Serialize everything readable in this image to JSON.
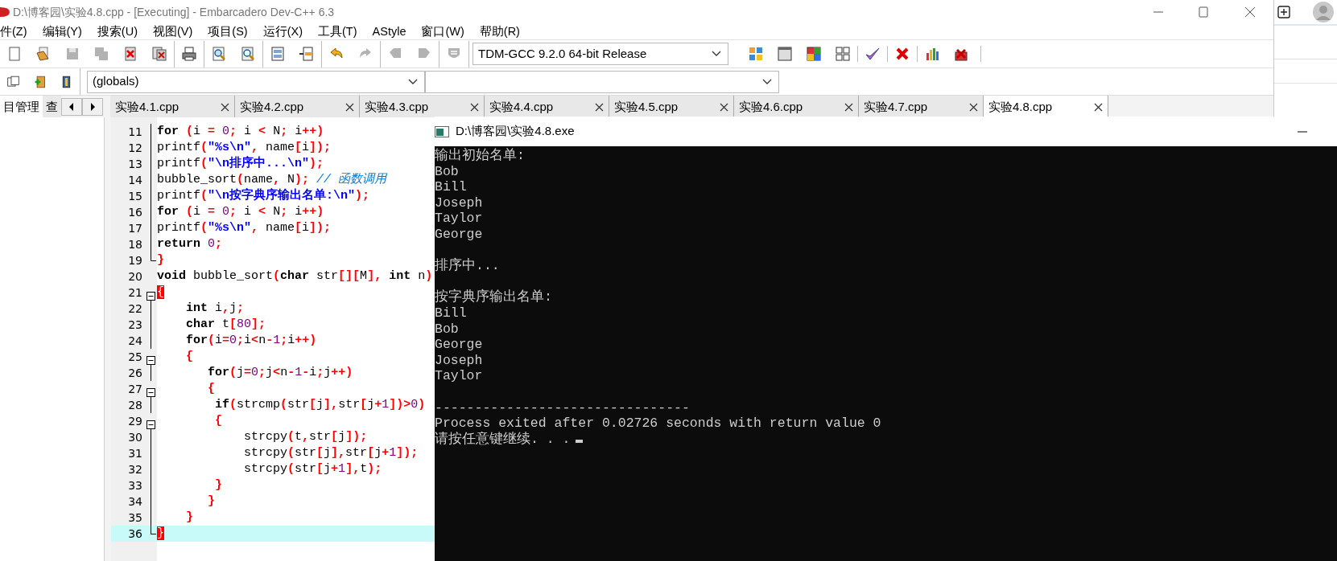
{
  "window": {
    "title": "D:\\博客园\\实验4.8.cpp - [Executing] - Embarcadero Dev-C++ 6.3"
  },
  "menu": [
    "件(Z)",
    "编辑(Y)",
    "搜索(U)",
    "视图(V)",
    "项目(S)",
    "运行(X)",
    "工具(T)",
    "AStyle",
    "窗口(W)",
    "帮助(R)"
  ],
  "toolbar": {
    "buttons": [
      {
        "disabled": false
      },
      {
        "disabled": false
      },
      {
        "disabled": true
      },
      {
        "disabled": true
      },
      {
        "disabled": false
      },
      {
        "disabled": false
      },
      {
        "disabled": false
      },
      {
        "disabled": false
      },
      {
        "disabled": false
      },
      {
        "disabled": false
      },
      {
        "disabled": false
      },
      {
        "disabled": false
      },
      {
        "disabled": true
      },
      {
        "disabled": true
      },
      {
        "disabled": true
      },
      {
        "disabled": true
      }
    ],
    "compiler": "TDM-GCC 9.2.0 64-bit Release",
    "tools": [
      {
        "disabled": false
      },
      {
        "disabled": false
      },
      {
        "disabled": false
      },
      {
        "disabled": false
      },
      {
        "disabled": false
      },
      {
        "disabled": false
      },
      {
        "disabled": false
      },
      {
        "disabled": false
      }
    ]
  },
  "toolbar2": {
    "buttons": [
      {
        "disabled": false
      },
      {
        "disabled": false
      },
      {
        "disabled": false
      }
    ],
    "scope": "(globals)"
  },
  "side_tabs": [
    {
      "label": "目管理",
      "selected": true
    },
    {
      "label": "查",
      "selected": false
    }
  ],
  "file_tabs": [
    {
      "label": "实验4.1.cpp",
      "selected": false
    },
    {
      "label": "实验4.2.cpp",
      "selected": false
    },
    {
      "label": "实验4.3.cpp",
      "selected": false
    },
    {
      "label": "实验4.4.cpp",
      "selected": false
    },
    {
      "label": "实验4.5.cpp",
      "selected": false
    },
    {
      "label": "实验4.6.cpp",
      "selected": false
    },
    {
      "label": "实验4.7.cpp",
      "selected": false
    },
    {
      "label": "实验4.8.cpp",
      "selected": true
    }
  ],
  "editor": {
    "lines": [
      {
        "number": "11",
        "current": false,
        "collapsible": false,
        "code": [
          {
            "kind": "keyword",
            "text": "for"
          },
          {
            "kind": "symbol",
            "text": " ("
          },
          {
            "kind": "plain",
            "text": "i "
          },
          {
            "kind": "symbol",
            "text": "="
          },
          {
            "kind": "number",
            "text": " 0"
          },
          {
            "kind": "symbol",
            "text": ";"
          },
          {
            "kind": "plain",
            "text": " i "
          },
          {
            "kind": "symbol",
            "text": "<"
          },
          {
            "kind": "plain",
            "text": " N"
          },
          {
            "kind": "symbol",
            "text": ";"
          },
          {
            "kind": "plain",
            "text": " i"
          },
          {
            "kind": "symbol",
            "text": "++)"
          }
        ]
      },
      {
        "number": "12",
        "current": false,
        "collapsible": false,
        "code": [
          {
            "kind": "plain",
            "text": "printf"
          },
          {
            "kind": "symbol",
            "text": "("
          },
          {
            "kind": "string",
            "text": "\"%s\\n\""
          },
          {
            "kind": "symbol",
            "text": ","
          },
          {
            "kind": "plain",
            "text": " name"
          },
          {
            "kind": "symbol",
            "text": "["
          },
          {
            "kind": "plain",
            "text": "i"
          },
          {
            "kind": "symbol",
            "text": "]);"
          }
        ]
      },
      {
        "number": "13",
        "current": false,
        "collapsible": false,
        "code": [
          {
            "kind": "plain",
            "text": "printf"
          },
          {
            "kind": "symbol",
            "text": "("
          },
          {
            "kind": "string",
            "text": "\"\\n排序中...\\n\""
          },
          {
            "kind": "symbol",
            "text": ");"
          }
        ]
      },
      {
        "number": "14",
        "current": false,
        "collapsible": false,
        "code": [
          {
            "kind": "plain",
            "text": "bubble_sort"
          },
          {
            "kind": "symbol",
            "text": "("
          },
          {
            "kind": "plain",
            "text": "name"
          },
          {
            "kind": "symbol",
            "text": ","
          },
          {
            "kind": "plain",
            "text": " N"
          },
          {
            "kind": "symbol",
            "text": ");"
          },
          {
            "kind": "comment",
            "text": " // 函数调用"
          }
        ]
      },
      {
        "number": "15",
        "current": false,
        "collapsible": false,
        "code": [
          {
            "kind": "plain",
            "text": "printf"
          },
          {
            "kind": "symbol",
            "text": "("
          },
          {
            "kind": "string",
            "text": "\"\\n按字典序输出名单:\\n\""
          },
          {
            "kind": "symbol",
            "text": ");"
          }
        ]
      },
      {
        "number": "16",
        "current": false,
        "collapsible": false,
        "code": [
          {
            "kind": "keyword",
            "text": "for"
          },
          {
            "kind": "symbol",
            "text": " ("
          },
          {
            "kind": "plain",
            "text": "i "
          },
          {
            "kind": "symbol",
            "text": "="
          },
          {
            "kind": "number",
            "text": " 0"
          },
          {
            "kind": "symbol",
            "text": ";"
          },
          {
            "kind": "plain",
            "text": " i "
          },
          {
            "kind": "symbol",
            "text": "<"
          },
          {
            "kind": "plain",
            "text": " N"
          },
          {
            "kind": "symbol",
            "text": ";"
          },
          {
            "kind": "plain",
            "text": " i"
          },
          {
            "kind": "symbol",
            "text": "++)"
          }
        ]
      },
      {
        "number": "17",
        "current": false,
        "collapsible": false,
        "code": [
          {
            "kind": "plain",
            "text": "printf"
          },
          {
            "kind": "symbol",
            "text": "("
          },
          {
            "kind": "string",
            "text": "\"%s\\n\""
          },
          {
            "kind": "symbol",
            "text": ","
          },
          {
            "kind": "plain",
            "text": " name"
          },
          {
            "kind": "symbol",
            "text": "["
          },
          {
            "kind": "plain",
            "text": "i"
          },
          {
            "kind": "symbol",
            "text": "]);"
          }
        ]
      },
      {
        "number": "18",
        "current": false,
        "collapsible": false,
        "code": [
          {
            "kind": "keyword",
            "text": "return"
          },
          {
            "kind": "number",
            "text": " 0"
          },
          {
            "kind": "symbol",
            "text": ";"
          }
        ]
      },
      {
        "number": "19",
        "current": false,
        "collapsible": false,
        "code": [
          {
            "kind": "symbol",
            "text": "}"
          }
        ]
      },
      {
        "number": "20",
        "current": false,
        "collapsible": false,
        "code": [
          {
            "kind": "keyword",
            "text": "void"
          },
          {
            "kind": "plain",
            "text": " bubble_sort"
          },
          {
            "kind": "symbol",
            "text": "("
          },
          {
            "kind": "keyword",
            "text": "char"
          },
          {
            "kind": "plain",
            "text": " str"
          },
          {
            "kind": "symbol",
            "text": "[]["
          },
          {
            "kind": "plain",
            "text": "M"
          },
          {
            "kind": "symbol",
            "text": "],"
          },
          {
            "kind": "keyword",
            "text": " int"
          },
          {
            "kind": "plain",
            "text": " n"
          },
          {
            "kind": "symbol",
            "text": ")"
          }
        ]
      },
      {
        "number": "21",
        "current": false,
        "collapsible": true,
        "code": [
          {
            "kind": "match",
            "text": "{"
          }
        ]
      },
      {
        "number": "22",
        "current": false,
        "collapsible": false,
        "code": [
          {
            "kind": "keyword",
            "text": "    int"
          },
          {
            "kind": "plain",
            "text": " i"
          },
          {
            "kind": "symbol",
            "text": ","
          },
          {
            "kind": "plain",
            "text": "j"
          },
          {
            "kind": "symbol",
            "text": ";"
          }
        ]
      },
      {
        "number": "23",
        "current": false,
        "collapsible": false,
        "code": [
          {
            "kind": "keyword",
            "text": "    char"
          },
          {
            "kind": "plain",
            "text": " t"
          },
          {
            "kind": "symbol",
            "text": "["
          },
          {
            "kind": "number",
            "text": "80"
          },
          {
            "kind": "symbol",
            "text": "];"
          }
        ]
      },
      {
        "number": "24",
        "current": false,
        "collapsible": false,
        "code": [
          {
            "kind": "keyword",
            "text": "    for"
          },
          {
            "kind": "symbol",
            "text": "("
          },
          {
            "kind": "plain",
            "text": "i"
          },
          {
            "kind": "symbol",
            "text": "="
          },
          {
            "kind": "number",
            "text": "0"
          },
          {
            "kind": "symbol",
            "text": ";"
          },
          {
            "kind": "plain",
            "text": "i"
          },
          {
            "kind": "symbol",
            "text": "<"
          },
          {
            "kind": "plain",
            "text": "n"
          },
          {
            "kind": "symbol",
            "text": "-"
          },
          {
            "kind": "number",
            "text": "1"
          },
          {
            "kind": "symbol",
            "text": ";"
          },
          {
            "kind": "plain",
            "text": "i"
          },
          {
            "kind": "symbol",
            "text": "++)"
          }
        ]
      },
      {
        "number": "25",
        "current": false,
        "collapsible": true,
        "code": [
          {
            "kind": "symbol",
            "text": "    {"
          }
        ]
      },
      {
        "number": "26",
        "current": false,
        "collapsible": false,
        "code": [
          {
            "kind": "keyword",
            "text": "       for"
          },
          {
            "kind": "symbol",
            "text": "("
          },
          {
            "kind": "plain",
            "text": "j"
          },
          {
            "kind": "symbol",
            "text": "="
          },
          {
            "kind": "number",
            "text": "0"
          },
          {
            "kind": "symbol",
            "text": ";"
          },
          {
            "kind": "plain",
            "text": "j"
          },
          {
            "kind": "symbol",
            "text": "<"
          },
          {
            "kind": "plain",
            "text": "n"
          },
          {
            "kind": "symbol",
            "text": "-"
          },
          {
            "kind": "number",
            "text": "1"
          },
          {
            "kind": "symbol",
            "text": "-"
          },
          {
            "kind": "plain",
            "text": "i"
          },
          {
            "kind": "symbol",
            "text": ";"
          },
          {
            "kind": "plain",
            "text": "j"
          },
          {
            "kind": "symbol",
            "text": "++)"
          }
        ]
      },
      {
        "number": "27",
        "current": false,
        "collapsible": true,
        "code": [
          {
            "kind": "symbol",
            "text": "       {"
          }
        ]
      },
      {
        "number": "28",
        "current": false,
        "collapsible": false,
        "code": [
          {
            "kind": "keyword",
            "text": "        if"
          },
          {
            "kind": "symbol",
            "text": "("
          },
          {
            "kind": "plain",
            "text": "strcmp"
          },
          {
            "kind": "symbol",
            "text": "("
          },
          {
            "kind": "plain",
            "text": "str"
          },
          {
            "kind": "symbol",
            "text": "["
          },
          {
            "kind": "plain",
            "text": "j"
          },
          {
            "kind": "symbol",
            "text": "],"
          },
          {
            "kind": "plain",
            "text": "str"
          },
          {
            "kind": "symbol",
            "text": "["
          },
          {
            "kind": "plain",
            "text": "j"
          },
          {
            "kind": "symbol",
            "text": "+"
          },
          {
            "kind": "number",
            "text": "1"
          },
          {
            "kind": "symbol",
            "text": "])>"
          },
          {
            "kind": "number",
            "text": "0"
          },
          {
            "kind": "symbol",
            "text": ")"
          }
        ]
      },
      {
        "number": "29",
        "current": false,
        "collapsible": true,
        "code": [
          {
            "kind": "symbol",
            "text": "        {"
          }
        ]
      },
      {
        "number": "30",
        "current": false,
        "collapsible": false,
        "code": [
          {
            "kind": "plain",
            "text": "            strcpy"
          },
          {
            "kind": "symbol",
            "text": "("
          },
          {
            "kind": "plain",
            "text": "t"
          },
          {
            "kind": "symbol",
            "text": ","
          },
          {
            "kind": "plain",
            "text": "str"
          },
          {
            "kind": "symbol",
            "text": "["
          },
          {
            "kind": "plain",
            "text": "j"
          },
          {
            "kind": "symbol",
            "text": "]);"
          }
        ]
      },
      {
        "number": "31",
        "current": false,
        "collapsible": false,
        "code": [
          {
            "kind": "plain",
            "text": "            strcpy"
          },
          {
            "kind": "symbol",
            "text": "("
          },
          {
            "kind": "plain",
            "text": "str"
          },
          {
            "kind": "symbol",
            "text": "["
          },
          {
            "kind": "plain",
            "text": "j"
          },
          {
            "kind": "symbol",
            "text": "],"
          },
          {
            "kind": "plain",
            "text": "str"
          },
          {
            "kind": "symbol",
            "text": "["
          },
          {
            "kind": "plain",
            "text": "j"
          },
          {
            "kind": "symbol",
            "text": "+"
          },
          {
            "kind": "number",
            "text": "1"
          },
          {
            "kind": "symbol",
            "text": "]);"
          }
        ]
      },
      {
        "number": "32",
        "current": false,
        "collapsible": false,
        "code": [
          {
            "kind": "plain",
            "text": "            strcpy"
          },
          {
            "kind": "symbol",
            "text": "("
          },
          {
            "kind": "plain",
            "text": "str"
          },
          {
            "kind": "symbol",
            "text": "["
          },
          {
            "kind": "plain",
            "text": "j"
          },
          {
            "kind": "symbol",
            "text": "+"
          },
          {
            "kind": "number",
            "text": "1"
          },
          {
            "kind": "symbol",
            "text": "],"
          },
          {
            "kind": "plain",
            "text": "t"
          },
          {
            "kind": "symbol",
            "text": ");"
          }
        ]
      },
      {
        "number": "33",
        "current": false,
        "collapsible": false,
        "code": [
          {
            "kind": "symbol",
            "text": "        }"
          }
        ]
      },
      {
        "number": "34",
        "current": false,
        "collapsible": false,
        "code": [
          {
            "kind": "symbol",
            "text": "       }"
          }
        ]
      },
      {
        "number": "35",
        "current": false,
        "collapsible": false,
        "code": [
          {
            "kind": "symbol",
            "text": "    }"
          }
        ]
      },
      {
        "number": "36",
        "current": true,
        "collapsible": false,
        "code": [
          {
            "kind": "match",
            "text": "}"
          }
        ]
      }
    ]
  },
  "console": {
    "title": "D:\\博客园\\实验4.8.exe",
    "lines": [
      {
        "text": "输出初始名单:",
        "space_before": false
      },
      {
        "text": "Bob",
        "space_before": false
      },
      {
        "text": "Bill",
        "space_before": false
      },
      {
        "text": "Joseph",
        "space_before": false
      },
      {
        "text": "Taylor",
        "space_before": false
      },
      {
        "text": "George",
        "space_before": false
      },
      {
        "text": "排序中...",
        "space_before": true
      },
      {
        "text": "按字典序输出名单:",
        "space_before": true
      },
      {
        "text": "Bill",
        "space_before": false
      },
      {
        "text": "Bob",
        "space_before": false
      },
      {
        "text": "George",
        "space_before": false
      },
      {
        "text": "Joseph",
        "space_before": false
      },
      {
        "text": "Taylor",
        "space_before": false
      },
      {
        "text": "--------------------------------",
        "space_before": true
      },
      {
        "text": "Process exited after 0.02726 seconds with return value 0",
        "space_before": false
      },
      {
        "text": "请按任意键继续. . .",
        "space_before": false,
        "cursor": true
      }
    ]
  }
}
